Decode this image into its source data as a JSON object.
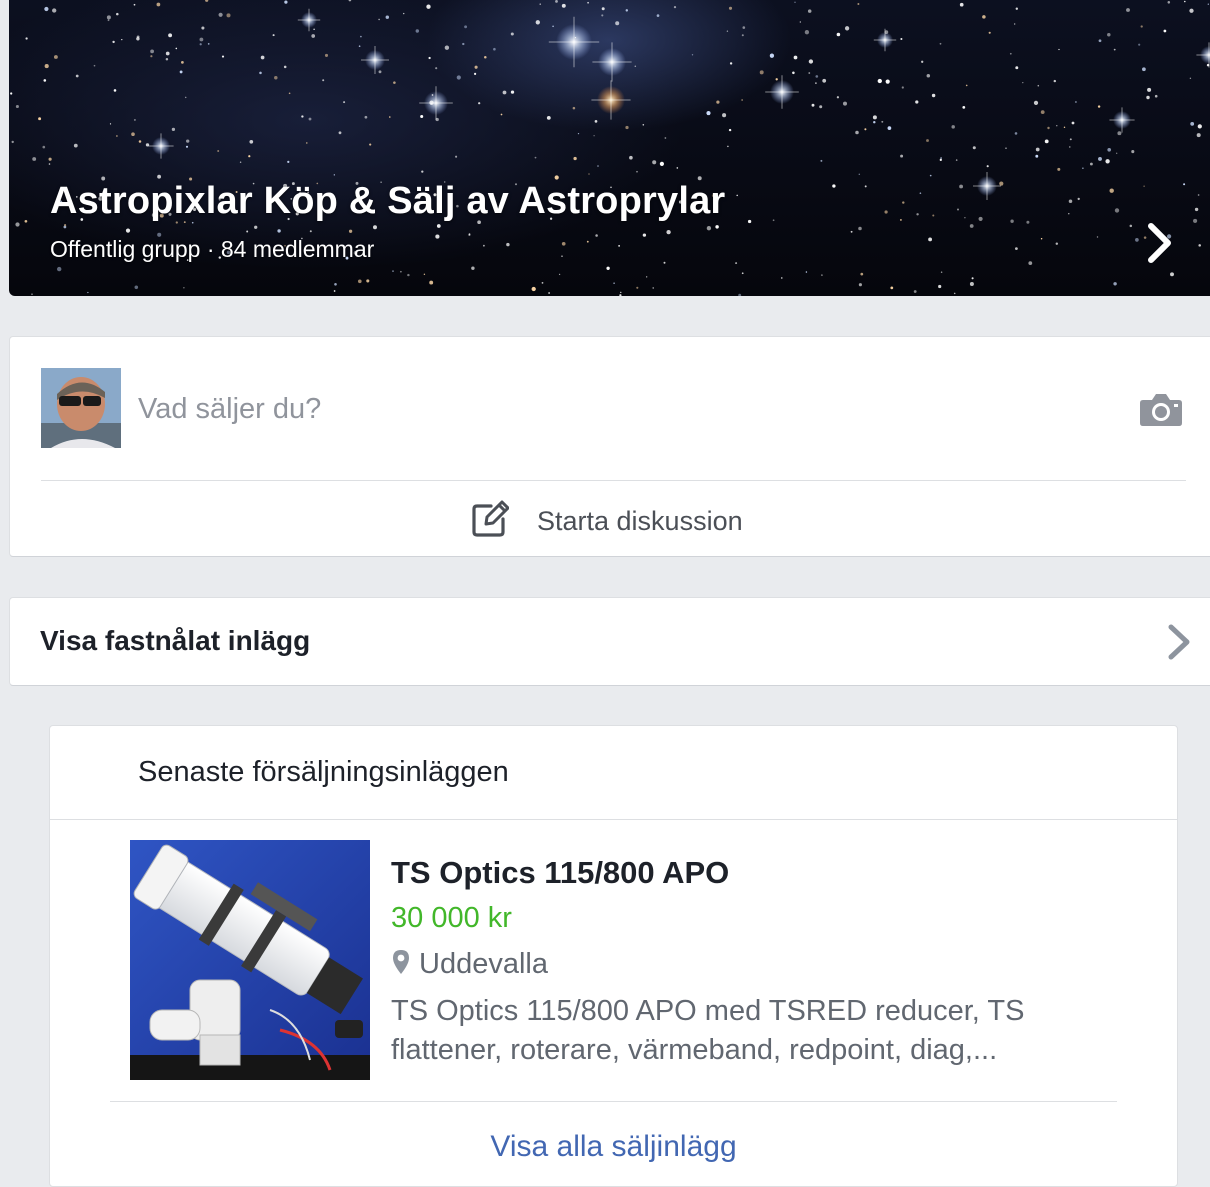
{
  "group": {
    "name": "Astropixlar Köp & Sälj av Astroprylar",
    "subtitle": "Offentlig grupp · 84 medlemmar",
    "cover_icon": "chevron-right-icon"
  },
  "composer": {
    "placeholder": "Vad säljer du?",
    "camera_icon": "camera-icon",
    "discussion_label": "Starta diskussion",
    "discussion_icon": "edit-icon"
  },
  "pinned": {
    "label": "Visa fastnålat inlägg",
    "icon": "chevron-right-icon"
  },
  "sales": {
    "header": "Senaste försäljningsinläggen",
    "listing": {
      "title": "TS Optics 115/800 APO",
      "price": "30 000 kr",
      "location": "Uddevalla",
      "location_icon": "map-pin-icon",
      "description": "TS Optics 115/800 APO med TSRED reducer, TS flattener, roterare, värmeband, redpoint, diag,..."
    },
    "see_all": "Visa alla säljinlägg"
  },
  "colors": {
    "background": "#e9ebee",
    "price": "#42b72a",
    "link": "#4267b2",
    "text": "#1d2129",
    "secondary": "#616770"
  }
}
